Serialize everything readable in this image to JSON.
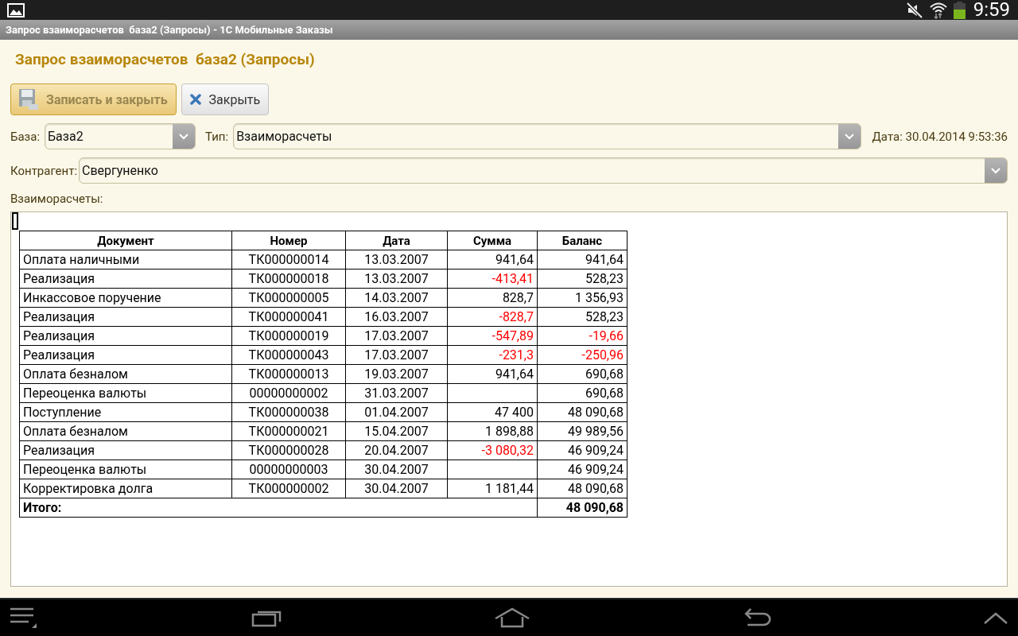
{
  "status_bar": {
    "time": "9:59"
  },
  "window": {
    "title": "Запрос взаиморасчетов  база2 (Запросы) - 1С Мобильные Заказы"
  },
  "form": {
    "heading": "Запрос взаиморасчетов  база2 (Запросы)",
    "buttons": [
      {
        "kind": "save",
        "label": "Записать и закрыть",
        "default": true
      },
      {
        "kind": "close",
        "label": "Закрыть",
        "default": false
      }
    ],
    "fields_row": [
      {
        "label": "База:",
        "value": "База2"
      },
      {
        "label": "Тип:",
        "value": "Взаиморасчеты"
      }
    ],
    "date": "Дата: 30.04.2014 9:53:36",
    "counterparty": {
      "label": "Контрагент:",
      "value": "Свергуненко"
    },
    "report_label": "Взаиморасчеты:"
  },
  "table": {
    "columns": [
      "Документ",
      "Номер",
      "Дата",
      "Сумма",
      "Баланс"
    ],
    "rows": [
      {
        "document": "Оплата наличными",
        "number": "ТК000000014",
        "date": "13.03.2007",
        "sum": "941,64",
        "sum_negative": false,
        "balance": "941,64",
        "balance_negative": false
      },
      {
        "document": "Реализация",
        "number": "ТК000000018",
        "date": "13.03.2007",
        "sum": "-413,41",
        "sum_negative": true,
        "balance": "528,23",
        "balance_negative": false
      },
      {
        "document": "Инкассовое поручение",
        "number": "ТК000000005",
        "date": "14.03.2007",
        "sum": "828,7",
        "sum_negative": false,
        "balance": "1 356,93",
        "balance_negative": false
      },
      {
        "document": "Реализация",
        "number": "ТК000000041",
        "date": "16.03.2007",
        "sum": "-828,7",
        "sum_negative": true,
        "balance": "528,23",
        "balance_negative": false
      },
      {
        "document": "Реализация",
        "number": "ТК000000019",
        "date": "17.03.2007",
        "sum": "-547,89",
        "sum_negative": true,
        "balance": "-19,66",
        "balance_negative": true
      },
      {
        "document": "Реализация",
        "number": "ТК000000043",
        "date": "17.03.2007",
        "sum": "-231,3",
        "sum_negative": true,
        "balance": "-250,96",
        "balance_negative": true
      },
      {
        "document": "Оплата безналом",
        "number": "ТК000000013",
        "date": "19.03.2007",
        "sum": "941,64",
        "sum_negative": false,
        "balance": "690,68",
        "balance_negative": false
      },
      {
        "document": "Переоценка валюты",
        "number": "00000000002",
        "date": "31.03.2007",
        "balance": "690,68",
        "balance_negative": false
      },
      {
        "document": "Поступление",
        "number": "ТК000000038",
        "date": "01.04.2007",
        "sum": "47 400",
        "sum_negative": false,
        "balance": "48 090,68",
        "balance_negative": false
      },
      {
        "document": "Оплата безналом",
        "number": "ТК000000021",
        "date": "15.04.2007",
        "sum": "1 898,88",
        "sum_negative": false,
        "balance": "49 989,56",
        "balance_negative": false
      },
      {
        "document": "Реализация",
        "number": "ТК000000028",
        "date": "20.04.2007",
        "sum": "-3 080,32",
        "sum_negative": true,
        "balance": "46 909,24",
        "balance_negative": false
      },
      {
        "document": "Переоценка валюты",
        "number": "00000000003",
        "date": "30.04.2007",
        "balance": "46 909,24",
        "balance_negative": false
      },
      {
        "document": "Корректировка долга",
        "number": "ТК000000002",
        "date": "30.04.2007",
        "sum": "1 181,44",
        "sum_negative": false,
        "balance": "48 090,68",
        "balance_negative": false
      }
    ],
    "total": {
      "label": "Итого:",
      "balance": "48 090,68"
    }
  }
}
